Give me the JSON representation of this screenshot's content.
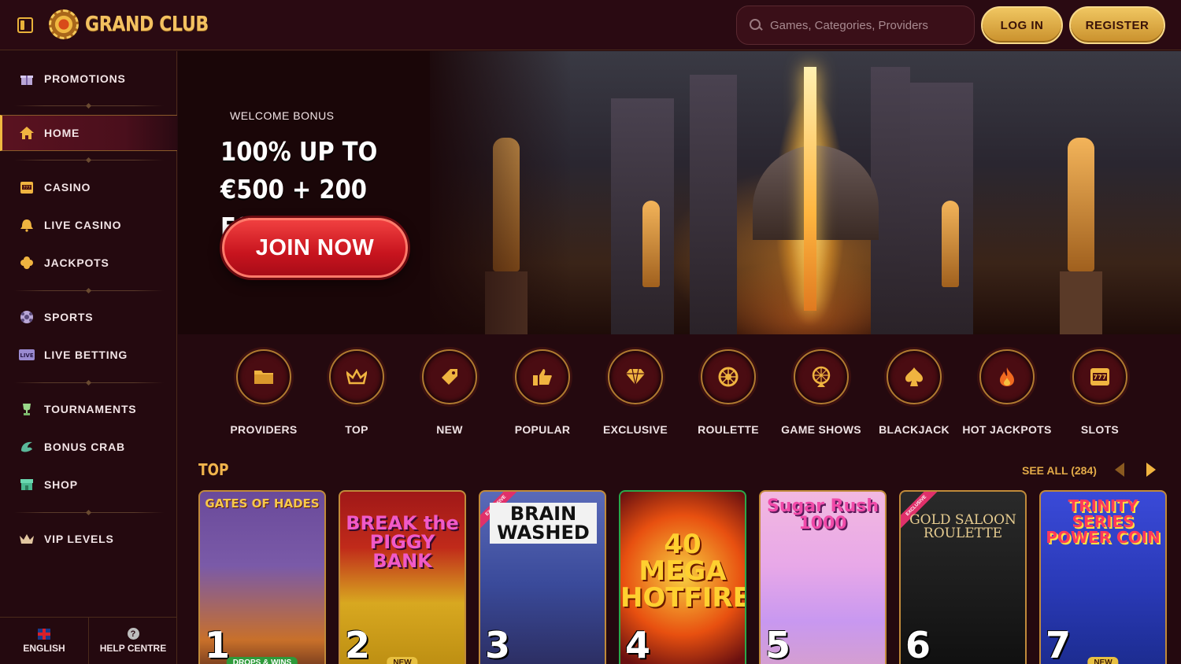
{
  "header": {
    "logo_text": "GRAND CLUB",
    "search_placeholder": "Games, Categories, Providers",
    "login_label": "LOG IN",
    "register_label": "REGISTER"
  },
  "sidebar": {
    "items": [
      {
        "label": "PROMOTIONS",
        "icon": "gift-icon"
      },
      {
        "label": "HOME",
        "icon": "home-icon",
        "active": true
      },
      {
        "label": "CASINO",
        "icon": "slot-machine-icon"
      },
      {
        "label": "LIVE CASINO",
        "icon": "bell-icon"
      },
      {
        "label": "JACKPOTS",
        "icon": "clover-icon"
      },
      {
        "label": "SPORTS",
        "icon": "soccer-ball-icon"
      },
      {
        "label": "LIVE BETTING",
        "icon": "live-icon"
      },
      {
        "label": "TOURNAMENTS",
        "icon": "trophy-icon"
      },
      {
        "label": "BONUS CRAB",
        "icon": "crab-claw-icon"
      },
      {
        "label": "SHOP",
        "icon": "shop-icon"
      },
      {
        "label": "VIP LEVELS",
        "icon": "crown-icon"
      }
    ],
    "footer": {
      "language_label": "ENGLISH",
      "help_label": "HELP CENTRE"
    }
  },
  "hero": {
    "eyebrow": "WELCOME BONUS",
    "headline_line1": "100% UP TO",
    "headline_line2": "€500 + 200 FS",
    "cta_label": "JOIN NOW"
  },
  "categories": [
    {
      "label": "PROVIDERS",
      "icon": "folder-icon"
    },
    {
      "label": "TOP",
      "icon": "crown-icon"
    },
    {
      "label": "NEW",
      "icon": "tag-icon"
    },
    {
      "label": "POPULAR",
      "icon": "thumbs-up-icon"
    },
    {
      "label": "EXCLUSIVE",
      "icon": "diamond-icon"
    },
    {
      "label": "ROULETTE",
      "icon": "roulette-icon"
    },
    {
      "label": "GAME SHOWS",
      "icon": "wheel-icon"
    },
    {
      "label": "BLACKJACK",
      "icon": "spade-icon"
    },
    {
      "label": "HOT JACKPOTS",
      "icon": "flame-icon"
    },
    {
      "label": "SLOTS",
      "icon": "slot-machine-icon"
    }
  ],
  "top_section": {
    "title": "TOP",
    "see_all_label": "SEE ALL (284)",
    "games": [
      {
        "rank": "1",
        "title": "GATES OF HADES",
        "tag": "DROPS & WINS"
      },
      {
        "rank": "2",
        "title": "BREAK the PIGGY BANK",
        "tag": "NEW"
      },
      {
        "rank": "3",
        "title": "BRAIN WASHED",
        "ribbon": "EXCLUSIVE"
      },
      {
        "rank": "4",
        "title": "40 MEGA HOTFIRE"
      },
      {
        "rank": "5",
        "title": "Sugar Rush 1000"
      },
      {
        "rank": "6",
        "title": "GOLD SALOON ROULETTE",
        "ribbon": "EXCLUSIVE"
      },
      {
        "rank": "7",
        "title": "TRINITY SERIES POWER COIN",
        "tag": "NEW"
      }
    ]
  },
  "colors": {
    "background": "#24090f",
    "gold": "#f0b440",
    "cta_red": "#d8202a"
  }
}
